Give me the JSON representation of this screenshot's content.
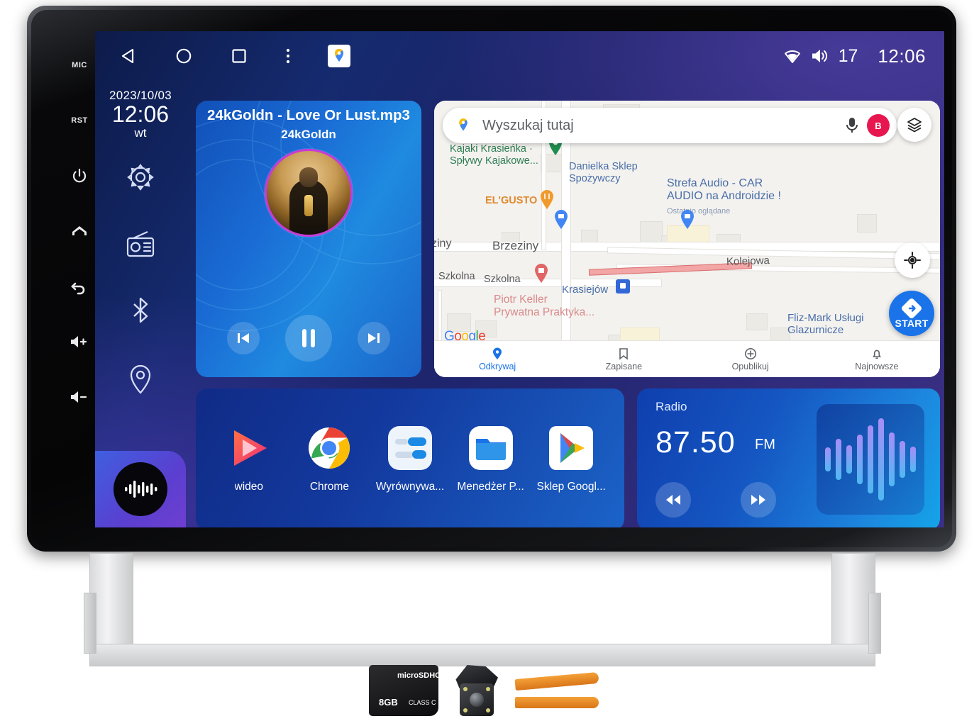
{
  "device": {
    "hardware_keys": [
      {
        "name": "mic-key",
        "label": "MIC"
      },
      {
        "name": "reset-key",
        "label": "RST"
      },
      {
        "name": "power-key",
        "label": ""
      },
      {
        "name": "home-key",
        "label": ""
      },
      {
        "name": "back-key",
        "label": ""
      },
      {
        "name": "volume-up-key",
        "label": ""
      },
      {
        "name": "volume-down-key",
        "label": ""
      }
    ]
  },
  "statusbar": {
    "nav": [
      {
        "name": "back",
        "icon": "back-triangle-icon"
      },
      {
        "name": "home",
        "icon": "home-circle-icon"
      },
      {
        "name": "recents",
        "icon": "recents-square-icon"
      },
      {
        "name": "overflow",
        "icon": "more-vertical-icon"
      },
      {
        "name": "maps-shortcut",
        "icon": "google-maps-icon"
      }
    ],
    "wifi_icon": "wifi-icon",
    "volume_icon": "volume-icon",
    "volume_level": "17",
    "clock": "12:06"
  },
  "left_dock": {
    "date": "2023/10/03",
    "time": "12:06",
    "weekday": "wt",
    "icons": [
      {
        "name": "settings",
        "icon": "gear-icon"
      },
      {
        "name": "radio",
        "icon": "radio-icon"
      },
      {
        "name": "bluetooth",
        "icon": "bluetooth-icon"
      },
      {
        "name": "navigation",
        "icon": "location-pin-icon"
      }
    ],
    "voice_button_icon": "waveform-icon"
  },
  "music": {
    "title": "24kGoldn - Love Or Lust.mp3",
    "artist": "24kGoldn",
    "controls": [
      {
        "name": "previous",
        "icon": "skip-previous-icon"
      },
      {
        "name": "pause",
        "icon": "pause-icon"
      },
      {
        "name": "next",
        "icon": "skip-next-icon"
      }
    ]
  },
  "map": {
    "search_placeholder": "Wyszukaj tutaj",
    "mic_icon": "microphone-icon",
    "avatar_initial": "B",
    "layers_icon": "layers-icon",
    "locate_icon": "my-location-icon",
    "start_label": "START",
    "start_icon": "navigation-arrow-icon",
    "google_watermark": [
      "G",
      "o",
      "o",
      "g",
      "l",
      "e"
    ],
    "labels": {
      "kayaks": "Kajaki Krasieńka ·\nSpływy Kajakowe...",
      "shop": "Danielka Sklep\nSpożywczy",
      "elgusto": "EL'GUSTO",
      "audio_shop": "Strefa Audio - CAR\nAUDIO na Androidzie !",
      "audio_shop_sub": "Ostatnio oglądane",
      "brzeziny": "Brzeziny",
      "brzeziny_left": "ziny",
      "szkolna_1": "Szkolna",
      "szkolna_2": "Szkolna",
      "keller": "Piotr Keller\nPrywatna Praktyka...",
      "krasiejow": "Krasiejów",
      "kolejowa": "Kolejowa",
      "flizmark": "Fliz-Mark Usługi\nGlazurnicze"
    },
    "bottom_nav": [
      {
        "name": "explore",
        "label": "Odkrywaj",
        "icon": "pin-icon",
        "active": true
      },
      {
        "name": "saved",
        "label": "Zapisane",
        "icon": "bookmark-icon",
        "active": false
      },
      {
        "name": "contribute",
        "label": "Opublikuj",
        "icon": "plus-circle-icon",
        "active": false
      },
      {
        "name": "updates",
        "label": "Najnowsze",
        "icon": "bell-icon",
        "active": false
      }
    ]
  },
  "apps": [
    {
      "name": "wideo",
      "label": "wideo",
      "icon": "video-play-icon"
    },
    {
      "name": "chrome",
      "label": "Chrome",
      "icon": "chrome-icon"
    },
    {
      "name": "equalizer",
      "label": "Wyrównywa...",
      "icon": "sliders-icon"
    },
    {
      "name": "file-manager",
      "label": "Menedżer P...",
      "icon": "folder-icon"
    },
    {
      "name": "play-store",
      "label": "Sklep Googl...",
      "icon": "play-store-icon"
    }
  ],
  "radio": {
    "title": "Radio",
    "frequency": "87.50",
    "band": "FM",
    "controls": [
      {
        "name": "seek-down",
        "icon": "rewind-icon"
      },
      {
        "name": "seek-up",
        "icon": "fast-forward-icon"
      }
    ],
    "waveform_heights": [
      34,
      58,
      40,
      70,
      96,
      116,
      76,
      52,
      36
    ]
  },
  "accessories": {
    "sd_card": {
      "logo": "microSDHC",
      "capacity": "8GB",
      "class": "CLASS C"
    },
    "camera_name": "rear-view-camera",
    "pry_tool_name": "plastic-pry-tool"
  },
  "colors": {
    "accent_blue": "#1a73e8",
    "card_blue": "#1656c4",
    "avatar_pink": "#e8164f",
    "album_ring": "#c93ad6"
  }
}
